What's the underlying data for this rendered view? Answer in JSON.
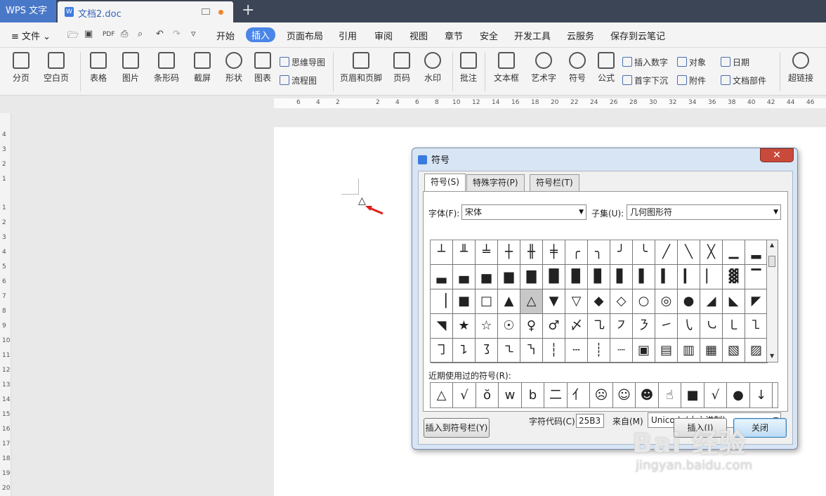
{
  "titlebar": {
    "app_name": "WPS 文字",
    "doc_title": "文档2.doc",
    "new_tab": "+"
  },
  "menubar": {
    "file": "≡ 文件 ⌄",
    "items": [
      "开始",
      "插入",
      "页面布局",
      "引用",
      "审阅",
      "视图",
      "章节",
      "安全",
      "开发工具",
      "云服务",
      "保存到云笔记"
    ],
    "active": "插入"
  },
  "ribbon": {
    "big": [
      "分页",
      "空白页",
      "表格",
      "图片",
      "条形码",
      "截屏",
      "形状",
      "图表",
      "页眉和页脚",
      "页码",
      "水印",
      "批注",
      "文本框",
      "艺术字",
      "符号",
      "公式",
      "超链接"
    ],
    "small": [
      "思维导图",
      "流程图",
      "插入数字",
      "首字下沉",
      "对象",
      "附件",
      "日期",
      "文档部件"
    ]
  },
  "ruler": {
    "h_ticks": [
      "6",
      "4",
      "2",
      "2",
      "2",
      "4",
      "6",
      "8",
      "10",
      "12",
      "14",
      "16",
      "18",
      "20",
      "22",
      "24",
      "26",
      "28",
      "30",
      "32",
      "34",
      "36",
      "38",
      "40",
      "42",
      "44",
      "46"
    ],
    "v_ticks": [
      "4",
      "3",
      "2",
      "1",
      "1",
      "2",
      "3",
      "4",
      "5",
      "6",
      "7",
      "8",
      "9",
      "10",
      "11",
      "12",
      "13",
      "14",
      "15",
      "16",
      "17",
      "18",
      "19",
      "20"
    ]
  },
  "page": {
    "inserted_symbol": "△"
  },
  "dialog": {
    "title": "符号",
    "close": "✕",
    "tabs": [
      "符号(S)",
      "特殊字符(P)",
      "符号栏(T)"
    ],
    "font_label": "字体(F):",
    "font_value": "宋体",
    "subset_label": "子集(U):",
    "subset_value": "几何图形符",
    "grid_rows": [
      [
        "┴",
        "╨",
        "╧",
        "┼",
        "╫",
        "╪",
        "╭",
        "╮",
        "╯",
        "╰",
        "╱",
        "╲",
        "╳",
        "▁",
        "▂"
      ],
      [
        "▃",
        "▄",
        "▅",
        "▆",
        "▇",
        "█",
        "▉",
        "▊",
        "▋",
        "▌",
        "▍",
        "▎",
        "▏",
        "▓",
        "▔"
      ],
      [
        "▕",
        "■",
        "□",
        "▲",
        "△",
        "▼",
        "▽",
        "◆",
        "◇",
        "○",
        "◎",
        "●",
        "◢",
        "◣",
        "◤"
      ],
      [
        "◥",
        "★",
        "☆",
        "☉",
        "♀",
        "♂",
        "〆",
        "㇈",
        "㇇",
        "㇋",
        "㇀",
        "㇂",
        "㇃",
        "㇄",
        "㇅"
      ],
      [
        "㇆",
        "㇊",
        "㇌",
        "㇍",
        "㇎",
        "┆",
        "┄",
        "┊",
        "┈",
        "▣",
        "▤",
        "▥",
        "▦",
        "▧",
        "▨"
      ]
    ],
    "selected_symbol": "△",
    "recent_label": "近期使用过的符号(R):",
    "recent": [
      "△",
      "√",
      "ŏ",
      "w",
      "b",
      "二",
      "亻",
      "☹",
      "☺",
      "☻",
      "☝",
      "■",
      "√",
      "●",
      "↓"
    ],
    "code_label": "字符代码(C):",
    "code_value": "25B3",
    "from_label": "来自(M)",
    "from_value": "Unicode(十六进制)",
    "insert_to_bar": "插入到符号栏(Y)",
    "insert": "插入(I)",
    "close_btn": "关闭"
  },
  "watermark": {
    "brand": "Bai 经验",
    "url": "jingyan.baidu.com"
  },
  "colors": {
    "title_bg": "#3c4555",
    "accent": "#4a86e8",
    "dialog_frame": "#d7e5f5",
    "close_red": "#c84a3a"
  }
}
